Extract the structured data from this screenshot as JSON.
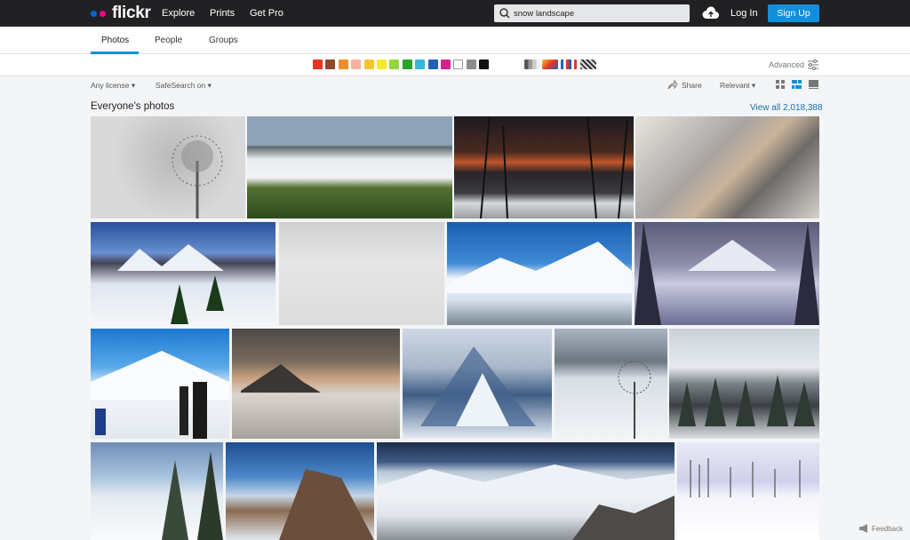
{
  "brand": {
    "name": "flickr",
    "dot_colors": [
      "#0063dc",
      "#ff0084"
    ]
  },
  "nav": {
    "explore": "Explore",
    "prints": "Prints",
    "get_pro": "Get Pro"
  },
  "search": {
    "value": "snow landscape"
  },
  "header": {
    "login": "Log In",
    "signup": "Sign Up"
  },
  "tabs": {
    "photos": "Photos",
    "people": "People",
    "groups": "Groups"
  },
  "color_filters": [
    "#e53623",
    "#8a4b2a",
    "#f08c2a",
    "#f7b0a0",
    "#f5c530",
    "#f5e92d",
    "#94d43f",
    "#26a42b",
    "#3ab6d9",
    "#2460b6",
    "#d3238f",
    "#ffffff",
    "#8a8d90",
    "#111111"
  ],
  "advanced_label": "Advanced",
  "filters": {
    "license": "Any license",
    "safesearch": "SafeSearch on",
    "share": "Share",
    "sort": "Relevant"
  },
  "section": {
    "title": "Everyone's photos",
    "view_all": "View all 2,018,388"
  },
  "feedback": "Feedback"
}
